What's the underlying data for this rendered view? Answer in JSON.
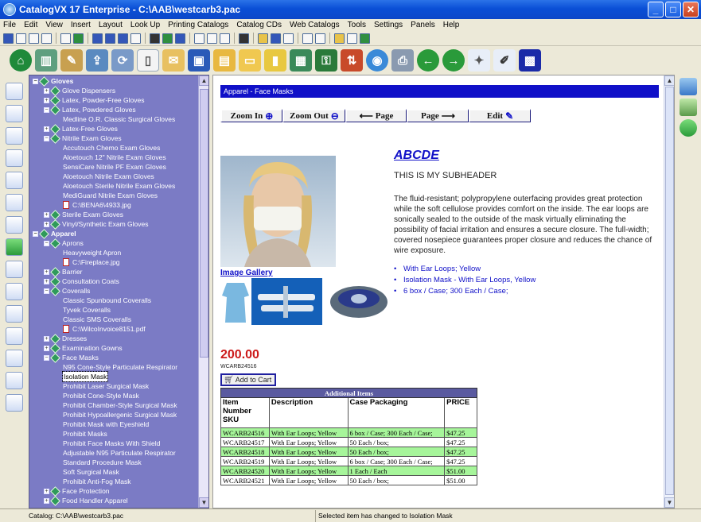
{
  "window": {
    "title": "CatalogVX 17 Enterprise - C:\\AAB\\westcarb3.pac"
  },
  "menu": [
    "File",
    "Edit",
    "View",
    "Insert",
    "Layout",
    "Look Up",
    "Printing Catalogs",
    "Catalog CDs",
    "Web Catalogs",
    "Tools",
    "Settings",
    "Panels",
    "Help"
  ],
  "tree": {
    "nodes": [
      {
        "label": "Gloves",
        "indent": 0,
        "exp": "-",
        "kind": "dia",
        "bold": true
      },
      {
        "label": "Glove Dispensers",
        "indent": 1,
        "exp": "+",
        "kind": "dia"
      },
      {
        "label": "Latex, Powder-Free Gloves",
        "indent": 1,
        "exp": "+",
        "kind": "dia"
      },
      {
        "label": "Latex, Powdered Gloves",
        "indent": 1,
        "exp": "-",
        "kind": "dia"
      },
      {
        "label": "Medline O.R. Classic Surgical Gloves",
        "indent": 2,
        "exp": "",
        "kind": "none"
      },
      {
        "label": "Latex-Free Gloves",
        "indent": 1,
        "exp": "+",
        "kind": "dia"
      },
      {
        "label": "Nitrile Exam Gloves",
        "indent": 1,
        "exp": "-",
        "kind": "dia"
      },
      {
        "label": "Accutouch Chemo Exam Gloves",
        "indent": 2,
        "exp": "",
        "kind": "none"
      },
      {
        "label": "Aloetouch 12\" Nitrile Exam Gloves",
        "indent": 2,
        "exp": "",
        "kind": "none"
      },
      {
        "label": "SensiCare Nitrile PF Exam Gloves",
        "indent": 2,
        "exp": "",
        "kind": "none"
      },
      {
        "label": "Aloetouch Nitrile Exam Gloves",
        "indent": 2,
        "exp": "",
        "kind": "none"
      },
      {
        "label": "Aloetouch Sterile Nitrile Exam Gloves",
        "indent": 2,
        "exp": "",
        "kind": "none"
      },
      {
        "label": "MediGuard Nitrile Exam Gloves",
        "indent": 2,
        "exp": "",
        "kind": "none"
      },
      {
        "label": "C:\\BENA6\\4933.jpg",
        "indent": 2,
        "exp": "",
        "kind": "pdf"
      },
      {
        "label": "Sterile Exam Gloves",
        "indent": 1,
        "exp": "+",
        "kind": "dia"
      },
      {
        "label": "Vinyl/Synthetic Exam Gloves",
        "indent": 1,
        "exp": "+",
        "kind": "dia"
      },
      {
        "label": "Apparel",
        "indent": 0,
        "exp": "-",
        "kind": "dia",
        "bold": true
      },
      {
        "label": "Aprons",
        "indent": 1,
        "exp": "-",
        "kind": "dia"
      },
      {
        "label": "Heavyweight Apron",
        "indent": 2,
        "exp": "",
        "kind": "none"
      },
      {
        "label": "C:\\Fireplace.jpg",
        "indent": 2,
        "exp": "",
        "kind": "pdf"
      },
      {
        "label": "Barrier",
        "indent": 1,
        "exp": "+",
        "kind": "dia"
      },
      {
        "label": "Consultation Coats",
        "indent": 1,
        "exp": "+",
        "kind": "dia"
      },
      {
        "label": "Coveralls",
        "indent": 1,
        "exp": "-",
        "kind": "dia"
      },
      {
        "label": "Classic Spunbound Coveralls",
        "indent": 2,
        "exp": "",
        "kind": "none"
      },
      {
        "label": "Tyvek Coveralls",
        "indent": 2,
        "exp": "",
        "kind": "none"
      },
      {
        "label": "Classic SMS Coveralls",
        "indent": 2,
        "exp": "",
        "kind": "none"
      },
      {
        "label": "C:\\WilcoInvoice8151.pdf",
        "indent": 2,
        "exp": "",
        "kind": "pdf"
      },
      {
        "label": "Dresses",
        "indent": 1,
        "exp": "+",
        "kind": "dia"
      },
      {
        "label": "Examination Gowns",
        "indent": 1,
        "exp": "+",
        "kind": "dia"
      },
      {
        "label": "Face Masks",
        "indent": 1,
        "exp": "-",
        "kind": "dia"
      },
      {
        "label": "N95 Cone-Style Particulate Respirator",
        "indent": 2,
        "exp": "",
        "kind": "none"
      },
      {
        "label": "Isolation Mask",
        "indent": 2,
        "exp": "",
        "kind": "none",
        "selected": true
      },
      {
        "label": "Prohibit Laser Surgical Mask",
        "indent": 2,
        "exp": "",
        "kind": "none"
      },
      {
        "label": "Prohibit Cone-Style Mask",
        "indent": 2,
        "exp": "",
        "kind": "none"
      },
      {
        "label": "Prohibit Chamber-Style Surgical Mask",
        "indent": 2,
        "exp": "",
        "kind": "none"
      },
      {
        "label": "Prohibit Hypoallergenic Surgical Mask",
        "indent": 2,
        "exp": "",
        "kind": "none"
      },
      {
        "label": "Prohibit Mask with Eyeshield",
        "indent": 2,
        "exp": "",
        "kind": "none"
      },
      {
        "label": "Prohibit Masks",
        "indent": 2,
        "exp": "",
        "kind": "none"
      },
      {
        "label": "Prohibit Face Masks With Shield",
        "indent": 2,
        "exp": "",
        "kind": "none"
      },
      {
        "label": "Adjustable N95 Particulate Respirator",
        "indent": 2,
        "exp": "",
        "kind": "none"
      },
      {
        "label": "Standard Procedure Mask",
        "indent": 2,
        "exp": "",
        "kind": "none"
      },
      {
        "label": "Soft Surgical Mask",
        "indent": 2,
        "exp": "",
        "kind": "none"
      },
      {
        "label": "Prohibit Anti-Fog Mask",
        "indent": 2,
        "exp": "",
        "kind": "none"
      },
      {
        "label": "Face Protection",
        "indent": 1,
        "exp": "+",
        "kind": "dia"
      },
      {
        "label": "Food Handler Apparel",
        "indent": 1,
        "exp": "+",
        "kind": "dia"
      }
    ]
  },
  "page": {
    "header": "Apparel - Face Masks",
    "zoom_in": "Zoom In",
    "zoom_out": "Zoom Out",
    "page_prev": "Page",
    "page_next": "Page",
    "edit": "Edit",
    "title": "ABCDE",
    "subheader": "THIS IS MY SUBHEADER",
    "description": "The fluid-resistant; polypropylene outerfacing provides great protection while the soft cellulose provides comfort on the inside. The ear loops are sonically sealed to the outside of the mask virtually eliminating the possibility of facial irritation and ensures a secure closure. The full-width; covered nosepiece guarantees proper closure and reduces the chance of wire exposure.",
    "bullets": [
      "With Ear Loops; Yellow",
      "Isolation Mask - With Ear Loops, Yellow",
      "6 box / Case; 300 Each / Case;"
    ],
    "image_gallery": "Image Gallery",
    "price": "200.00",
    "sku": "WCARB24516",
    "add_to_cart": "Add to Cart",
    "table": {
      "caption": "Additional Items",
      "headers": [
        "Item Number SKU",
        "Description",
        "Case Packaging",
        "PRICE"
      ],
      "rows": [
        [
          "WCARB24516",
          "With Ear Loops; Yellow",
          "6 box / Case; 300 Each / Case;",
          "$47.25"
        ],
        [
          "WCARB24517",
          "With Ear Loops; Yellow",
          "50 Each / box;",
          "$47.25"
        ],
        [
          "WCARB24518",
          "With Ear Loops; Yellow",
          "50 Each / box;",
          "$47.25"
        ],
        [
          "WCARB24519",
          "With Ear Loops; Yellow",
          "6 box / Case; 300 Each / Case;",
          "$47.25"
        ],
        [
          "WCARB24520",
          "With Ear Loops; Yellow",
          "1 Each / Each",
          "$51.00"
        ],
        [
          "WCARB24521",
          "With Ear Loops; Yellow",
          "50 Each / box;",
          "$51.00"
        ]
      ]
    }
  },
  "status": {
    "catalog": "Catalog: C:\\AAB\\westcarb3.pac",
    "message": "Selected item has changed to Isolation Mask"
  },
  "colors": {
    "tree_bg": "#7b7bc5",
    "header_blue": "#1010c8",
    "price_red": "#cc1a1a",
    "row_green": "#a6f59a"
  }
}
